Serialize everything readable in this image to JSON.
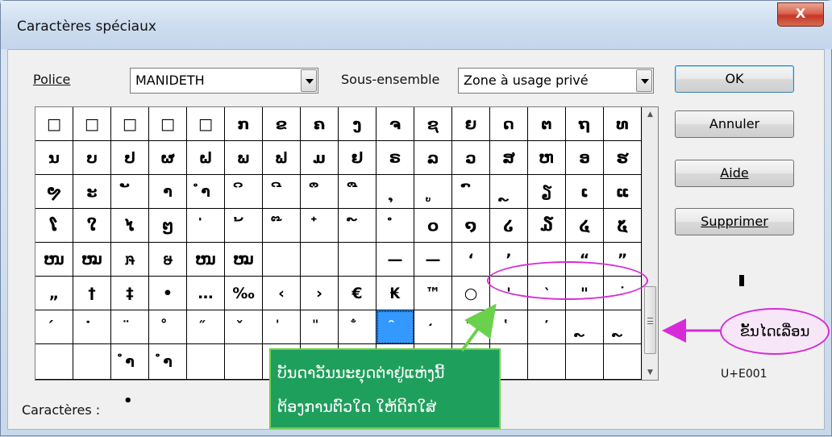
{
  "window": {
    "title": "Caractères spéciaux",
    "close_label": "X"
  },
  "font_row": {
    "police_label": "Police",
    "police_value": "MANIDETH",
    "subset_label": "Sous-ensemble",
    "subset_value": "Zone à usage privé"
  },
  "buttons": {
    "ok": "OK",
    "cancel": "Annuler",
    "help": "Aide",
    "delete": "Supprimer"
  },
  "grid": {
    "selected_index": 105,
    "cells": [
      "□",
      "□",
      "□",
      "□",
      "□",
      "ກ",
      "ຂ",
      "ຄ",
      "ງ",
      "ຈ",
      "ຊ",
      "ຍ",
      "ດ",
      "ຕ",
      "ຖ",
      "ທ",
      "ນ",
      "ບ",
      "ປ",
      "ຜ",
      "ຝ",
      "ພ",
      "ຟ",
      "ມ",
      "ຢ",
      "ຣ",
      "ລ",
      "ວ",
      "ສ",
      "ຫ",
      "ອ",
      "ຮ",
      "ຯ",
      "ະ",
      "ັ",
      "າ",
      "ຳ",
      "ິ",
      "ີ",
      "ຶ",
      "ື",
      "ຸ",
      "ູ",
      "ົ",
      "ຼ",
      "ຽ",
      "ເ",
      "ແ",
      "ໂ",
      "ໃ",
      "ໄ",
      "ໆ",
      "່",
      "້",
      "໊",
      "໋",
      "໌",
      "ໍ",
      "໐",
      "໑",
      "໒",
      "໓",
      "໔",
      "໕",
      "ໜ",
      "ໝ",
      "ໞ",
      "ໟ",
      "ໜ",
      "ໝ",
      "",
      "",
      "",
      "—",
      "—",
      "‘",
      "’",
      "",
      "“",
      "”",
      "„",
      "†",
      "‡",
      "•",
      "…",
      "‰",
      "‹",
      "›",
      "€",
      "₭",
      "™",
      "○",
      "'",
      "‵",
      "\"",
      "˙",
      "́",
      "̇",
      "̈",
      "̊",
      "̋",
      "̌",
      "̍",
      "̎",
      "̐",
      "̑",
      "̒",
      "̓",
      "̔",
      "̕",
      "ຼ",
      "ຼ",
      "",
      "",
      "ໍາ",
      "ໍາ",
      "",
      "",
      "",
      "",
      "",
      "",
      "",
      "",
      "",
      "",
      "",
      ""
    ]
  },
  "info": {
    "unicode_code": "U+E001",
    "chars_label": "Caractères :",
    "chars_value": "•"
  },
  "annotations": {
    "green_note_line1": "ບັນດາວັນນະຍຸດຕ່າຢູ່ແຫ່ງນີ້",
    "green_note_line2": "ຕ້ອງການຕົວໃດ ໃຫ້ດິກໃສ່",
    "scrollbar_label": "ຂັ້ນໄດເລື່ອນ",
    "accent_color": "#d62bd6",
    "note_color": "#1f9f5c"
  }
}
